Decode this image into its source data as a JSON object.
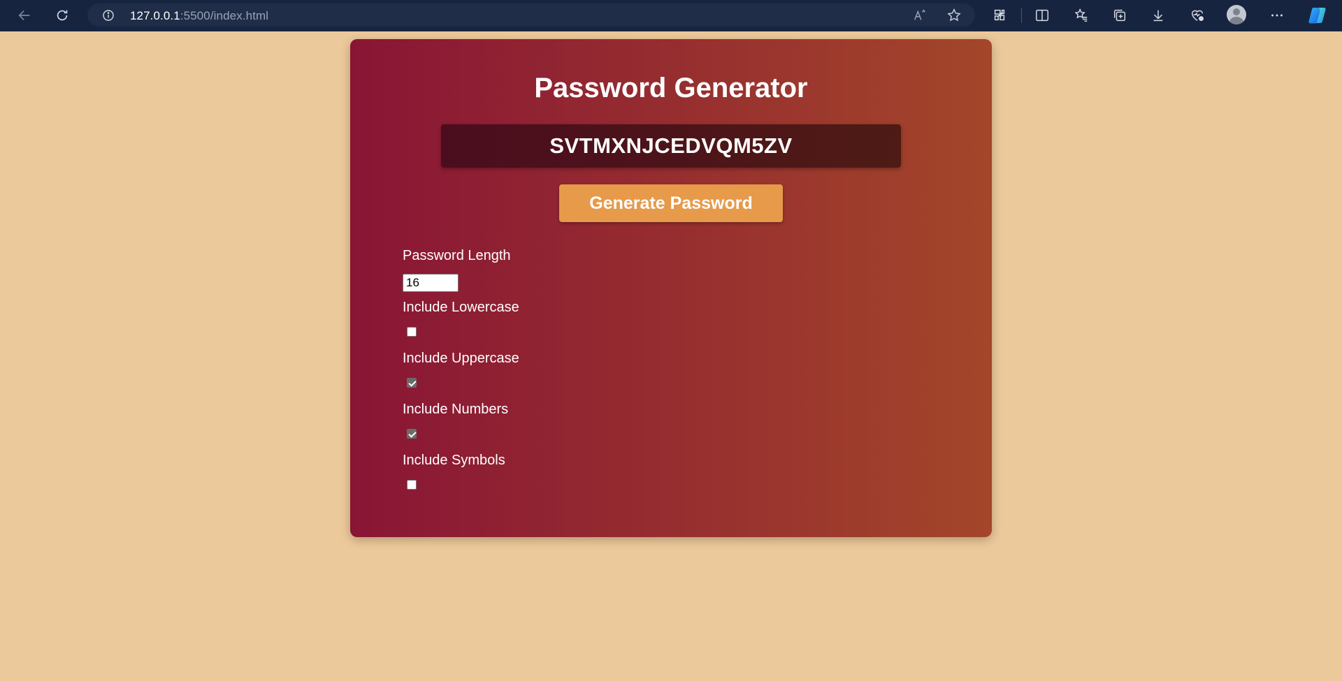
{
  "browser": {
    "url_host": "127.0.0.1",
    "url_path": ":5500/index.html",
    "icons": [
      "back-icon",
      "refresh-icon",
      "site-info-icon",
      "read-aloud-icon",
      "favorite-star-icon",
      "extensions-icon",
      "split-screen-icon",
      "favorites-icon",
      "collections-icon",
      "downloads-icon",
      "browser-essentials-icon",
      "profile-avatar",
      "more-options-icon",
      "copilot-icon"
    ]
  },
  "app": {
    "title": "Password Generator",
    "password": "SVTMXNJCEDVQM5ZV",
    "generate_label": "Generate Password",
    "length_label": "Password Length",
    "length_value": "16",
    "options": [
      {
        "label": "Include Lowercase",
        "checked": false
      },
      {
        "label": "Include Uppercase",
        "checked": true
      },
      {
        "label": "Include Numbers",
        "checked": true
      },
      {
        "label": "Include Symbols",
        "checked": false
      }
    ]
  },
  "colors": {
    "page_bg": "#ecc99b",
    "card_gradient_start": "#891535",
    "card_gradient_end": "#a3462a",
    "button_bg": "#e69a4a",
    "browser_bar": "#172440"
  }
}
